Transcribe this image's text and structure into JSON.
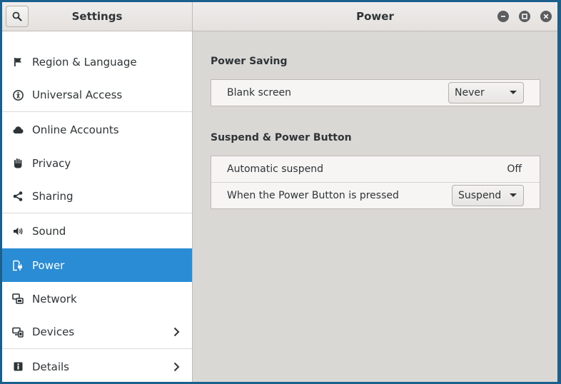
{
  "window": {
    "sidebar_title": "Settings",
    "panel_title": "Power"
  },
  "colors": {
    "accent": "#2a8cd4",
    "desktop": "#1b5f8c",
    "panel_bg": "#dad8d5"
  },
  "sidebar": {
    "items": [
      {
        "label": "Region & Language",
        "icon": "flag-icon",
        "active": false
      },
      {
        "label": "Universal Access",
        "icon": "accessibility-icon",
        "active": false
      },
      {
        "label": "Online Accounts",
        "icon": "cloud-icon",
        "active": false
      },
      {
        "label": "Privacy",
        "icon": "hand-icon",
        "active": false
      },
      {
        "label": "Sharing",
        "icon": "share-icon",
        "active": false
      },
      {
        "label": "Sound",
        "icon": "speaker-icon",
        "active": false
      },
      {
        "label": "Power",
        "icon": "power-plug-icon",
        "active": true
      },
      {
        "label": "Network",
        "icon": "network-icon",
        "active": false
      },
      {
        "label": "Devices",
        "icon": "devices-icon",
        "active": false,
        "has_submenu": true
      },
      {
        "label": "Details",
        "icon": "info-icon",
        "active": false,
        "has_submenu": true
      }
    ]
  },
  "power": {
    "power_saving": {
      "title": "Power Saving",
      "blank_screen_label": "Blank screen",
      "blank_screen_value": "Never"
    },
    "suspend": {
      "title": "Suspend & Power Button",
      "auto_suspend_label": "Automatic suspend",
      "auto_suspend_value": "Off",
      "power_button_label": "When the Power Button is pressed",
      "power_button_value": "Suspend"
    }
  }
}
